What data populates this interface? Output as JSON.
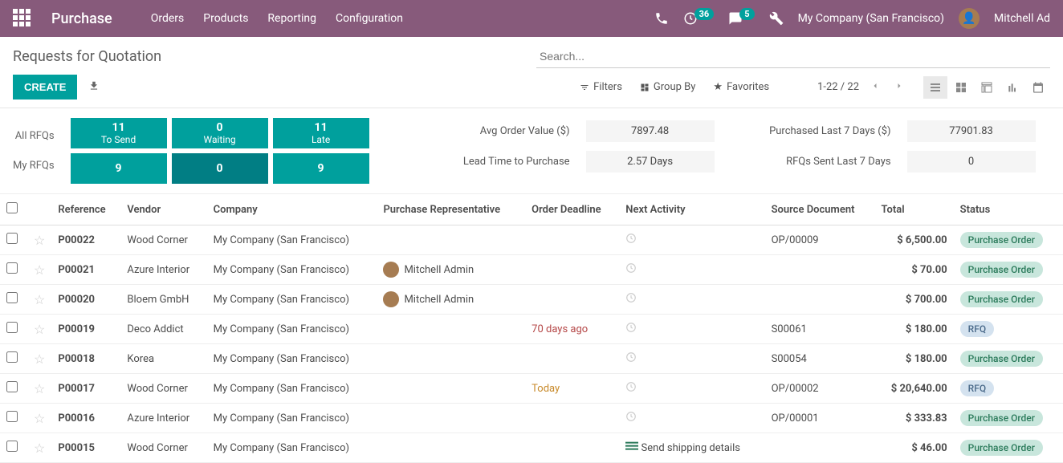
{
  "topnav": {
    "app_title": "Purchase",
    "links": [
      "Orders",
      "Products",
      "Reporting",
      "Configuration"
    ],
    "clock_badge": "36",
    "chat_badge": "5",
    "company": "My Company (San Francisco)",
    "user": "Mitchell Ad"
  },
  "header": {
    "breadcrumb": "Requests for Quotation",
    "search_placeholder": "Search...",
    "create_label": "CREATE",
    "filters_label": "Filters",
    "groupby_label": "Group By",
    "favorites_label": "Favorites",
    "pager": "1-22 / 22"
  },
  "dashboard": {
    "row_labels": [
      "All RFQs",
      "My RFQs"
    ],
    "col_labels": [
      "To Send",
      "Waiting",
      "Late"
    ],
    "cells": [
      [
        "11",
        "0",
        "11"
      ],
      [
        "9",
        "0",
        "9"
      ]
    ],
    "metrics": [
      {
        "label": "Avg Order Value ($)",
        "value": "7897.48"
      },
      {
        "label": "Purchased Last 7 Days ($)",
        "value": "77901.83"
      },
      {
        "label": "Lead Time to Purchase",
        "value": "2.57  Days"
      },
      {
        "label": "RFQs Sent Last 7 Days",
        "value": "0"
      }
    ]
  },
  "columns": [
    "Reference",
    "Vendor",
    "Company",
    "Purchase Representative",
    "Order Deadline",
    "Next Activity",
    "Source Document",
    "Total",
    "Status"
  ],
  "rows": [
    {
      "ref": "P00022",
      "vendor": "Wood Corner",
      "company": "My Company (San Francisco)",
      "rep": "",
      "deadline": "",
      "deadline_class": "",
      "activity": "clock",
      "source": "OP/00009",
      "total": "$ 6,500.00",
      "status": "Purchase Order",
      "status_class": "pill-po"
    },
    {
      "ref": "P00021",
      "vendor": "Azure Interior",
      "company": "My Company (San Francisco)",
      "rep": "Mitchell Admin",
      "deadline": "",
      "deadline_class": "",
      "activity": "clock",
      "source": "",
      "total": "$ 70.00",
      "status": "Purchase Order",
      "status_class": "pill-po"
    },
    {
      "ref": "P00020",
      "vendor": "Bloem GmbH",
      "company": "My Company (San Francisco)",
      "rep": "Mitchell Admin",
      "deadline": "",
      "deadline_class": "",
      "activity": "clock",
      "source": "",
      "total": "$ 700.00",
      "status": "Purchase Order",
      "status_class": "pill-po"
    },
    {
      "ref": "P00019",
      "vendor": "Deco Addict",
      "company": "My Company (San Francisco)",
      "rep": "",
      "deadline": "70 days ago",
      "deadline_class": "deadline-late",
      "activity": "clock",
      "source": "S00061",
      "total": "$ 180.00",
      "status": "RFQ",
      "status_class": "pill-rfq"
    },
    {
      "ref": "P00018",
      "vendor": "Korea",
      "company": "My Company (San Francisco)",
      "rep": "",
      "deadline": "",
      "deadline_class": "",
      "activity": "clock",
      "source": "S00054",
      "total": "$ 180.00",
      "status": "Purchase Order",
      "status_class": "pill-po"
    },
    {
      "ref": "P00017",
      "vendor": "Wood Corner",
      "company": "My Company (San Francisco)",
      "rep": "",
      "deadline": "Today",
      "deadline_class": "deadline-today",
      "activity": "clock",
      "source": "OP/00002",
      "total": "$ 20,640.00",
      "status": "RFQ",
      "status_class": "pill-rfq"
    },
    {
      "ref": "P00016",
      "vendor": "Azure Interior",
      "company": "My Company (San Francisco)",
      "rep": "",
      "deadline": "",
      "deadline_class": "",
      "activity": "clock",
      "source": "OP/00001",
      "total": "$ 333.83",
      "status": "Purchase Order",
      "status_class": "pill-po"
    },
    {
      "ref": "P00015",
      "vendor": "Wood Corner",
      "company": "My Company (San Francisco)",
      "rep": "",
      "deadline": "",
      "deadline_class": "",
      "activity": "text",
      "activity_text": "Send shipping details",
      "source": "",
      "total": "$ 46.00",
      "status": "Purchase Order",
      "status_class": "pill-po"
    }
  ]
}
